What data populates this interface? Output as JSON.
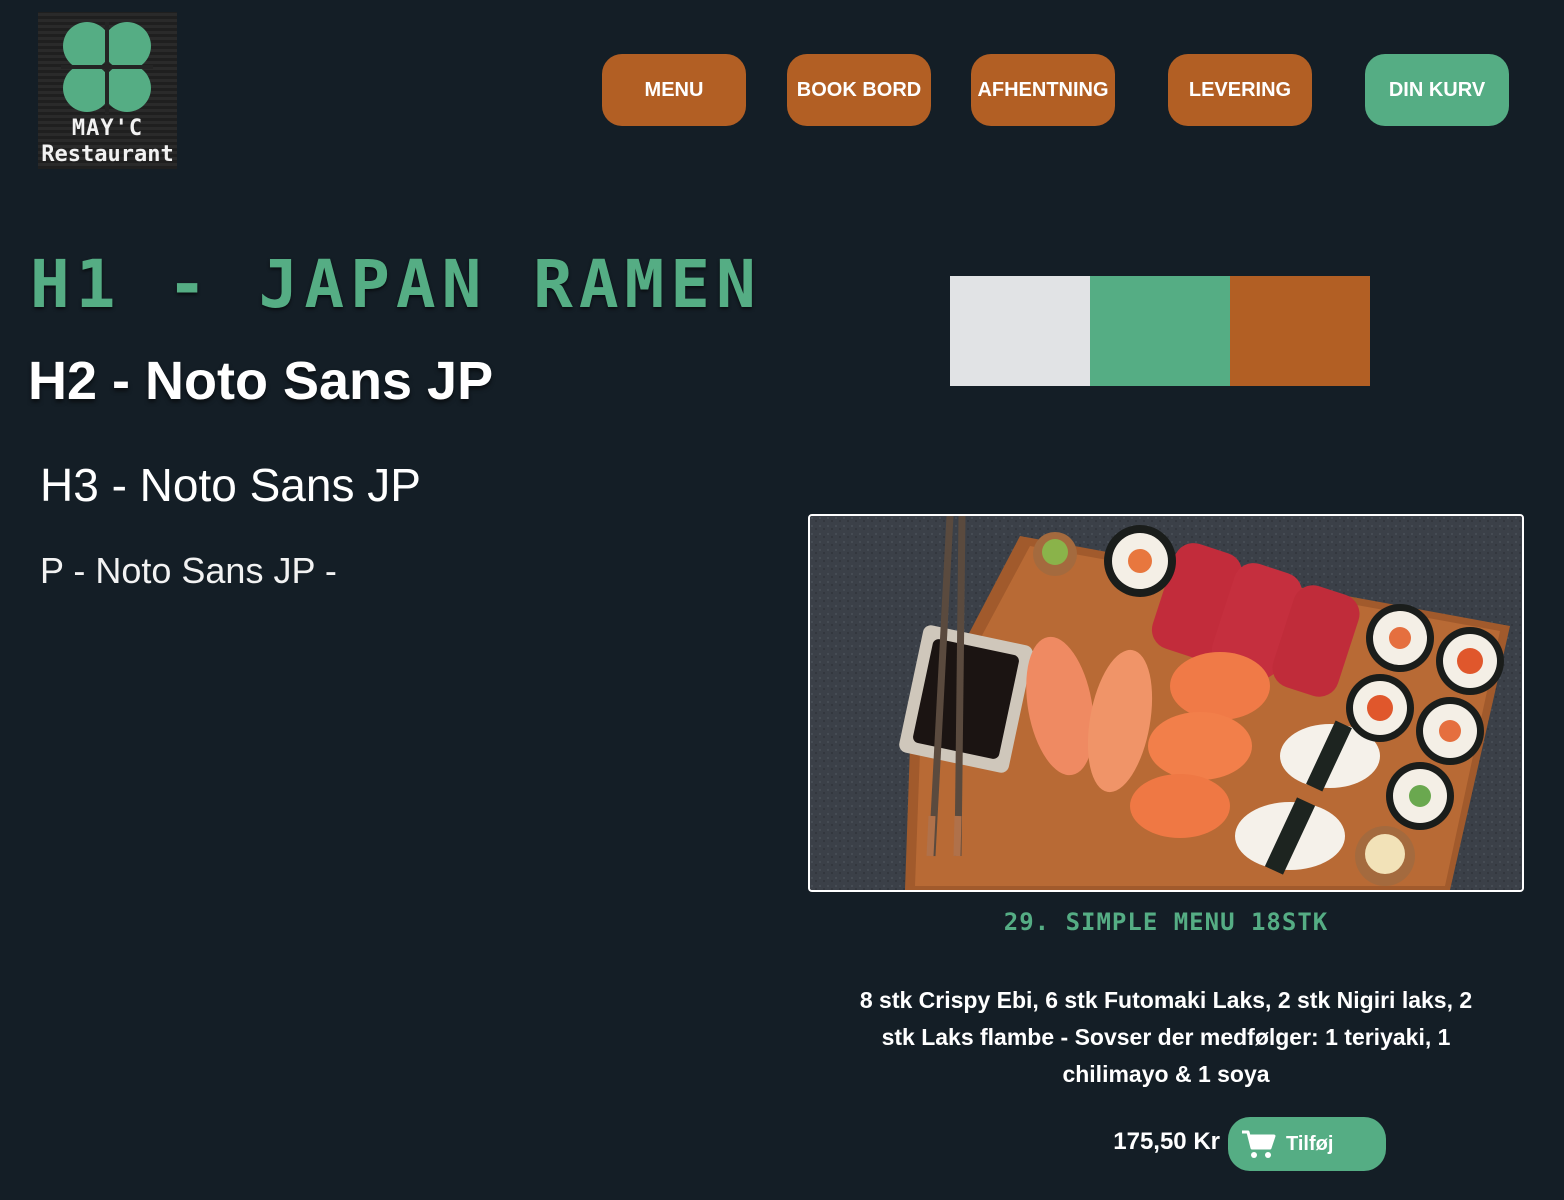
{
  "brand": {
    "name_line1": "MAY'C",
    "name_line2": "Restaurant",
    "logo_icon": "four-leaf-clover-icon"
  },
  "nav": {
    "menu": "MENU",
    "book": "BOOK BORD",
    "pickup": "AFHENTNING",
    "delivery": "LEVERING",
    "cart": "DIN KURV"
  },
  "typography": {
    "h1": "H1 - JAPAN RAMEN",
    "h2": "H2 - Noto Sans JP",
    "h3": "H3 - Noto Sans JP",
    "p": "P - Noto Sans JP -"
  },
  "palette": [
    "#e1e3e5",
    "#55ad84",
    "#b25f24"
  ],
  "colors": {
    "background": "#141e26",
    "accent_green": "#55ad84",
    "accent_orange": "#b25f24"
  },
  "product": {
    "title": "29. SIMPLE MENU 18STK",
    "description": "8 stk Crispy Ebi, 6 stk Futomaki Laks, 2 stk Nigiri laks, 2 stk Laks flambe - Sovser der medfølger: 1 teriyaki, 1 chilimayo & 1 soya",
    "price": "175,50 Kr",
    "add_label": "Tilføj",
    "add_icon": "shopping-cart-icon"
  }
}
